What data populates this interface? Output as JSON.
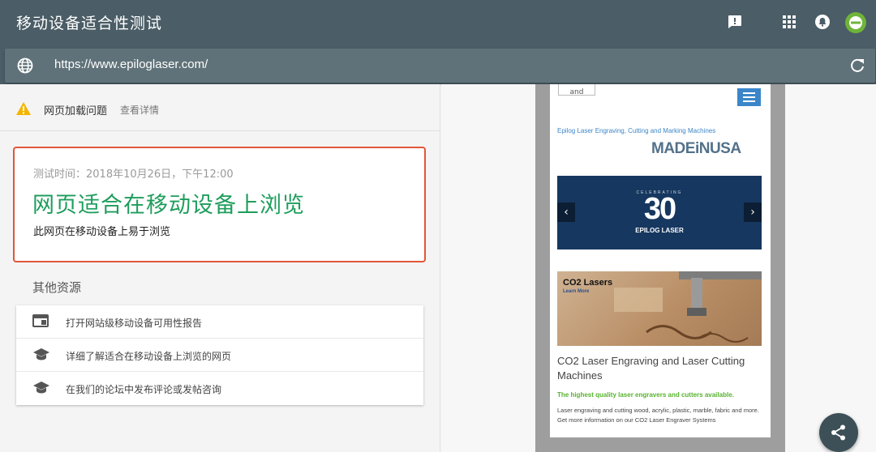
{
  "app": {
    "title": "移动设备适合性测试",
    "url": "https://www.epiloglaser.com/"
  },
  "toolbar_icons": [
    "feedback-icon",
    "apps-grid-icon",
    "notifications-icon",
    "account-avatar-icon"
  ],
  "warning": {
    "label": "网页加载问题",
    "link": "查看详情",
    "color": "#f4b400"
  },
  "result": {
    "test_time": "测试时间：2018年10月26日，下午12:00",
    "headline": "网页适合在移动设备上浏览",
    "subline": "此网页在移动设备上易于浏览",
    "headline_color": "#1e9d5c",
    "border_color": "#e2563a"
  },
  "resources": {
    "title": "其他资源",
    "items": [
      {
        "icon": "report-window-icon",
        "label": "打开网站级移动设备可用性报告"
      },
      {
        "icon": "graduation-cap-icon",
        "label": "详细了解适合在移动设备上浏览的网页"
      },
      {
        "icon": "graduation-cap-icon",
        "label": "在我们的论坛中发布评论或发帖咨询"
      }
    ]
  },
  "preview": {
    "logo_fragment": "and",
    "tagline": "Epilog Laser Engraving, Cutting and Marking Machines",
    "made_in": "MADEiNUSA",
    "banner": {
      "small_text": "CELEBRATING",
      "big_text": "30",
      "brand": "EPILOG LASER",
      "prev": "‹",
      "next": "›"
    },
    "co2_image": {
      "title": "CO2 Lasers",
      "learn_more": "Learn More"
    },
    "article_title": "CO2 Laser Engraving and Laser Cutting Machines",
    "green_line": "The highest quality laser engravers and cutters available.",
    "body": "Laser engraving and cutting wood, acrylic, plastic, marble, fabric and more. Get more information on our CO2 Laser Engraver Systems"
  },
  "fab": {
    "icon": "share-icon"
  }
}
